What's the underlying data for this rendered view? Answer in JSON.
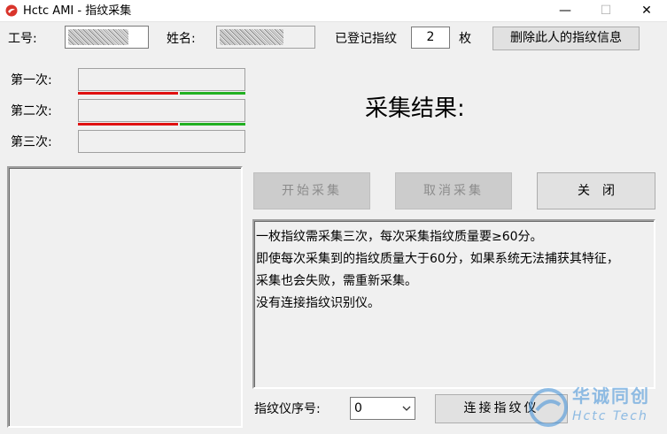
{
  "window": {
    "title": "Hctc AMI - 指纹采集",
    "minimize_glyph": "—",
    "maximize_glyph": "☐",
    "close_glyph": "✕",
    "icon": "app-logo-icon"
  },
  "header": {
    "employee_id_label": "工号:",
    "name_label": "姓名:",
    "registered_label": "已登记指纹",
    "registered_count": "2",
    "count_unit": "枚",
    "delete_button": "删除此人的指纹信息"
  },
  "samples": [
    {
      "label": "第一次:",
      "quality": 0.6
    },
    {
      "label": "第二次:",
      "quality": 0.6
    },
    {
      "label": "第三次:"
    }
  ],
  "result": {
    "label": "采集结果:"
  },
  "buttons": {
    "start": "开始采集",
    "cancel": "取消采集",
    "close": "关　闭",
    "connect": "连接指纹仪"
  },
  "messages": [
    "一枚指纹需采集三次，每次采集指纹质量要≥60分。",
    "即使每次采集到的指纹质量大于60分，如果系统无法捕获其特征，",
    "采集也会失败，需重新采集。",
    "没有连接指纹识别仪。"
  ],
  "device": {
    "serial_label": "指纹仪序号:",
    "serial_value": "0"
  },
  "watermark": {
    "line1": "华诚同创",
    "line2": "Hctc Tech"
  },
  "colors": {
    "quality_bad": "#e01010",
    "quality_good": "#22b022",
    "watermark": "#3d8fd8"
  }
}
